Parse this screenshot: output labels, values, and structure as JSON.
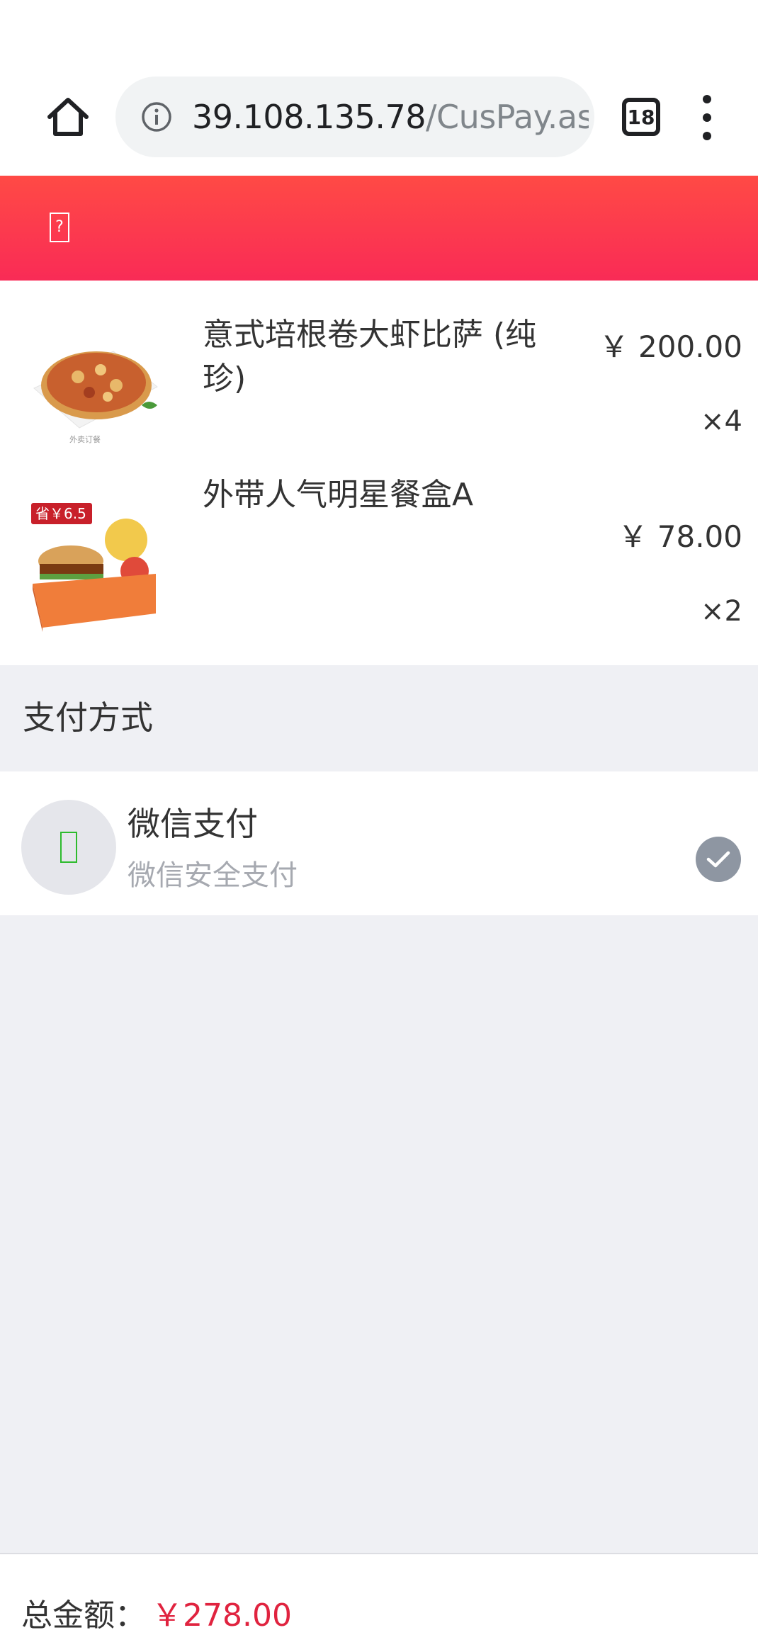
{
  "browser": {
    "url_host": "39.108.135.78",
    "url_path": "/CusPay.as",
    "tab_count": "18",
    "icons": {
      "home": "home-icon",
      "info": "info-icon",
      "menu": "more-vert-icon"
    }
  },
  "header": {
    "back_icon": "missing-glyph-icon",
    "background": "#ff4a45"
  },
  "order": {
    "items": [
      {
        "name": "意式培根卷大虾比萨 (纯珍)",
        "price": "￥ 200.00",
        "quantity": "×4",
        "thumb_caption": "外卖订餐"
      },
      {
        "name": "外带人气明星餐盒A",
        "price": "￥ 78.00",
        "quantity": "×2",
        "badge": "省￥6.5"
      }
    ]
  },
  "payment": {
    "section_title": "支付方式",
    "method_name": "微信支付",
    "method_desc": "微信安全支付",
    "selected": true,
    "accent": "#2dbb2d"
  },
  "footer": {
    "total_label": "总金额：",
    "total_amount": "￥278.00",
    "amount_color": "#e0233f"
  }
}
